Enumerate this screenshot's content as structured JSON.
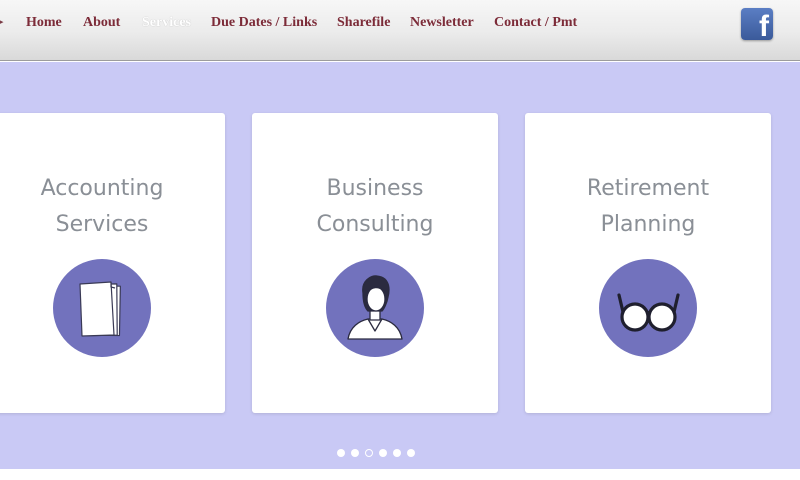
{
  "nav": {
    "items": [
      {
        "label": "Home",
        "active": false
      },
      {
        "label": "About",
        "active": false
      },
      {
        "label": "Services",
        "active": true
      },
      {
        "label": "Due Dates / Links",
        "active": false
      },
      {
        "label": "Sharefile",
        "active": false
      },
      {
        "label": "Newsletter",
        "active": false
      },
      {
        "label": "Contact / Pmt",
        "active": false
      }
    ],
    "facebook_icon": "facebook-icon",
    "edge_icon": "chevron-right-icon"
  },
  "services": {
    "cards": [
      {
        "line1": "Accounting",
        "line2": "Services",
        "icon": "documents-icon"
      },
      {
        "line1": "Business",
        "line2": "Consulting",
        "icon": "businesswoman-icon"
      },
      {
        "line1": "Retirement",
        "line2": "Planning",
        "icon": "glasses-icon"
      }
    ]
  },
  "carousel": {
    "dot_count": 6,
    "current_index": 2
  },
  "colors": {
    "nav_text": "#7c2b38",
    "band_background": "#c9c9f5",
    "icon_circle": "#7272bd",
    "card_title": "#8a8f96"
  }
}
